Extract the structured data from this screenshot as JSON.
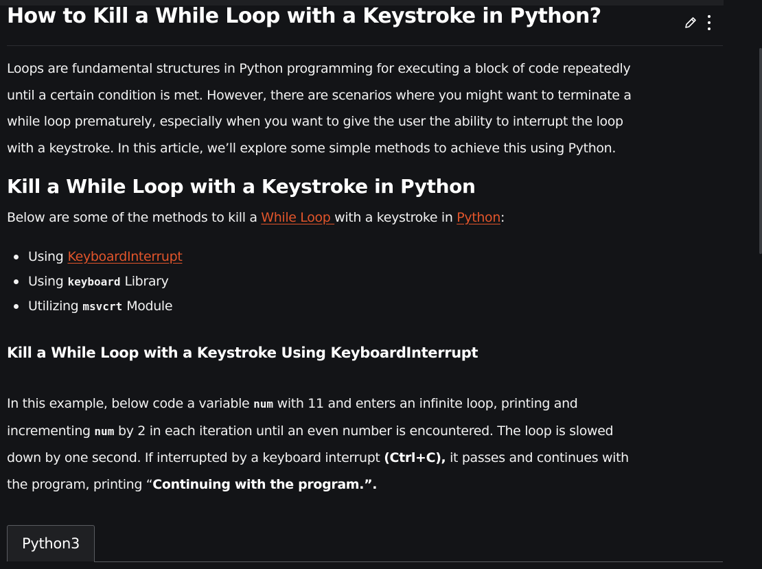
{
  "article": {
    "title": "How to Kill a While Loop with a Keystroke in Python?",
    "actions": {
      "edit_icon": "pencil-icon",
      "more_icon": "more-vertical-icon"
    },
    "intro_lines": [
      "Loops are fundamental structures in Python programming for executing a block of code repeatedly",
      "until a certain condition is met. However, there are scenarios where you might want to terminate a",
      "while loop prematurely, especially when you want to give the user the ability to interrupt the loop",
      "with a keystroke. In this article, we’ll explore some simple methods to achieve this using Python."
    ],
    "section_heading": "Kill a While Loop with a Keystroke in Python",
    "methods_intro": {
      "before": "Below are some of the methods to kill a ",
      "link1": "While Loop ",
      "middle": "with a keystroke in ",
      "link2": "Python",
      "after": ":"
    },
    "methods": [
      {
        "prefix": "Using",
        "link": "KeyboardInterrupt"
      },
      {
        "prefix": "Using",
        "code": "keyboard",
        "suffix": "Library"
      },
      {
        "prefix": "Utilizing",
        "code": "msvcrt",
        "suffix": "Module"
      }
    ],
    "subheading": "Kill a While Loop with a Keystroke Using KeyboardInterrupt",
    "example": {
      "l1_a": "In this example, below code a variable ",
      "l1_code": "num",
      "l1_b": " with 11 and enters an infinite loop, printing and",
      "l2_a": "incrementing ",
      "l2_code": "num",
      "l2_b": " by 2 in each iteration until an even number is encountered. The loop is slowed",
      "l3_a": "down by one second. If interrupted by a keyboard interrupt ",
      "l3_bold": "(Ctrl+C),",
      "l3_b": " it passes and continues with",
      "l4_a": "the program, printing “",
      "l4_bold": "Continuing with the program.”.",
      "l4_b": ""
    },
    "code_tab": "Python3"
  },
  "colors": {
    "background": "#131417",
    "text": "#f2f2f2",
    "link": "#e2552b",
    "border": "#5a5c61"
  }
}
